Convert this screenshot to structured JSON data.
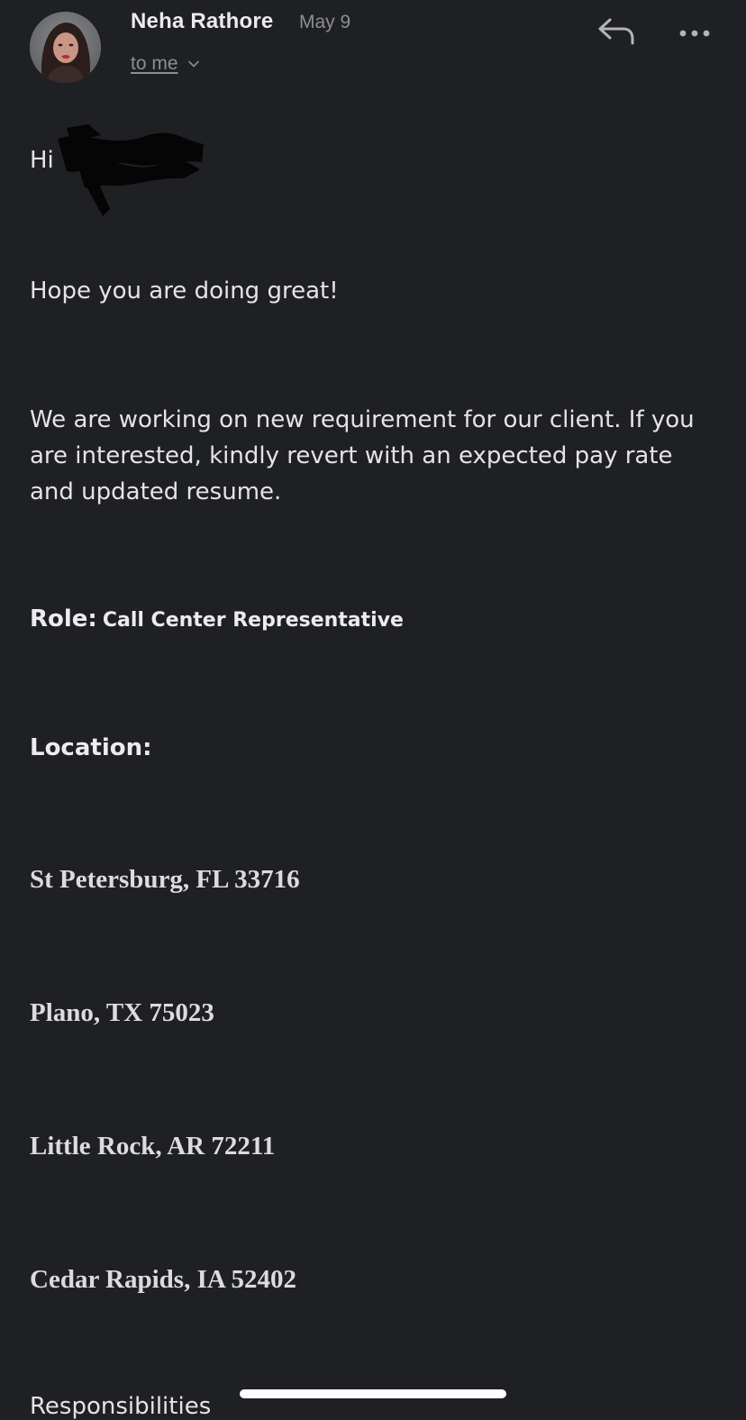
{
  "header": {
    "sender_name": "Neha Rathore",
    "date": "May 9",
    "recipient_label": "to me",
    "reply_icon": "reply-icon",
    "more_icon": "more-horizontal-icon",
    "expand_icon": "chevron-down-icon"
  },
  "colors": {
    "background": "#1f2024",
    "primary_text": "#e4e4e7",
    "secondary_text": "#8d8e93",
    "home_indicator": "#ffffff"
  },
  "message": {
    "greeting": "Hi",
    "opening": "Hope you are doing great!",
    "intro": "We are working on new requirement for our client. If you are interested, kindly revert with an expected pay rate and updated resume.",
    "role_label": "Role:",
    "role_value": "Call Center Representative",
    "location_label": "Location:",
    "locations": [
      "St Petersburg, FL 33716",
      "Plano, TX 75023",
      "Little Rock, AR 72211",
      "Cedar Rapids, IA 52402"
    ],
    "responsibilities_label": "Responsibilities"
  }
}
